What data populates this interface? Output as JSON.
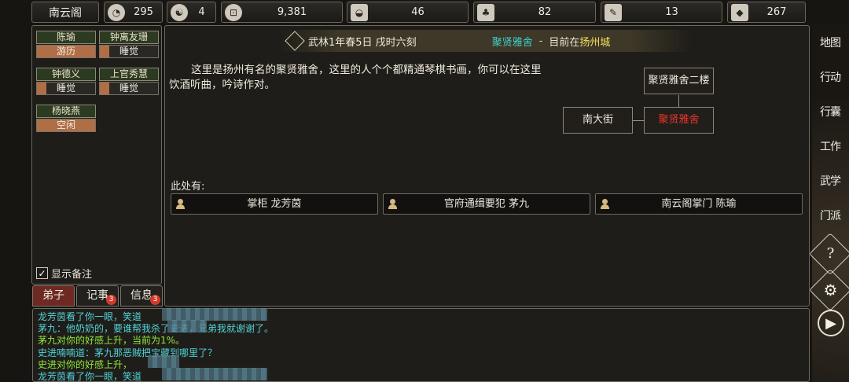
{
  "topbar": {
    "sect_name": "南云阁",
    "stats": [
      {
        "icon": "coin-bag-icon",
        "value": "295"
      },
      {
        "icon": "yin-yang-icon",
        "value": "4"
      },
      {
        "icon": "copper-coin-icon",
        "value": "9,381"
      },
      {
        "icon": "food-bowl-icon",
        "value": "46"
      },
      {
        "icon": "herb-icon",
        "value": "82"
      },
      {
        "icon": "scroll-icon",
        "value": "13"
      },
      {
        "icon": "stone-icon",
        "value": "267"
      }
    ]
  },
  "disciples": [
    {
      "name": "陈瑜",
      "status": "游历"
    },
    {
      "name": "钟离友珊",
      "status": "睡觉"
    },
    {
      "name": "钟德义",
      "status": "睡觉"
    },
    {
      "name": "上官秀慧",
      "status": "睡觉"
    },
    {
      "name": "杨晓燕",
      "status": "空闲"
    }
  ],
  "remark_label": "显示备注",
  "tabs": [
    {
      "label": "弟子",
      "badge": ""
    },
    {
      "label": "记事",
      "badge": "3"
    },
    {
      "label": "信息",
      "badge": "3"
    }
  ],
  "header": {
    "date": "武林1年春5日 戌时六刻",
    "location": "聚贤雅舍",
    "separator": "-",
    "current_prefix": "目前在",
    "city": "扬州城"
  },
  "description": "这里是扬州有名的聚贤雅舍，这里的人个个都精通琴棋书画，你可以在这里饮酒听曲，吟诗作对。",
  "map": {
    "north": "聚贤雅舍二楼",
    "west": "南大街",
    "current": "聚贤雅舍"
  },
  "here_label": "此处有:",
  "npcs": [
    "掌柜 龙芳茵",
    "官府通缉要犯 茅九",
    "南云阁掌门 陈瑜"
  ],
  "log": [
    {
      "text": "龙芳茵看了你一眼，笑道",
      "color": "cyan"
    },
    {
      "text": "茅九：他奶奶的，要谁帮我杀了史进，兄弟我就谢谢了。",
      "color": "cyan"
    },
    {
      "text": "茅九对你的好感上升，当前为1%。",
      "color": "green"
    },
    {
      "text": "史进喃喃道：茅九那恶贼把宝藏到哪里了？",
      "color": "cyan"
    },
    {
      "text": "史进对你的好感上升，",
      "color": "green"
    },
    {
      "text": "龙芳茵看了你一眼，笑道",
      "color": "cyan"
    }
  ],
  "sidebar": {
    "buttons": [
      "地图",
      "行动",
      "行囊",
      "工作",
      "武学",
      "门派"
    ],
    "help_icon": "question-icon",
    "settings_icon": "gear-icon",
    "play_icon": "play-icon"
  }
}
